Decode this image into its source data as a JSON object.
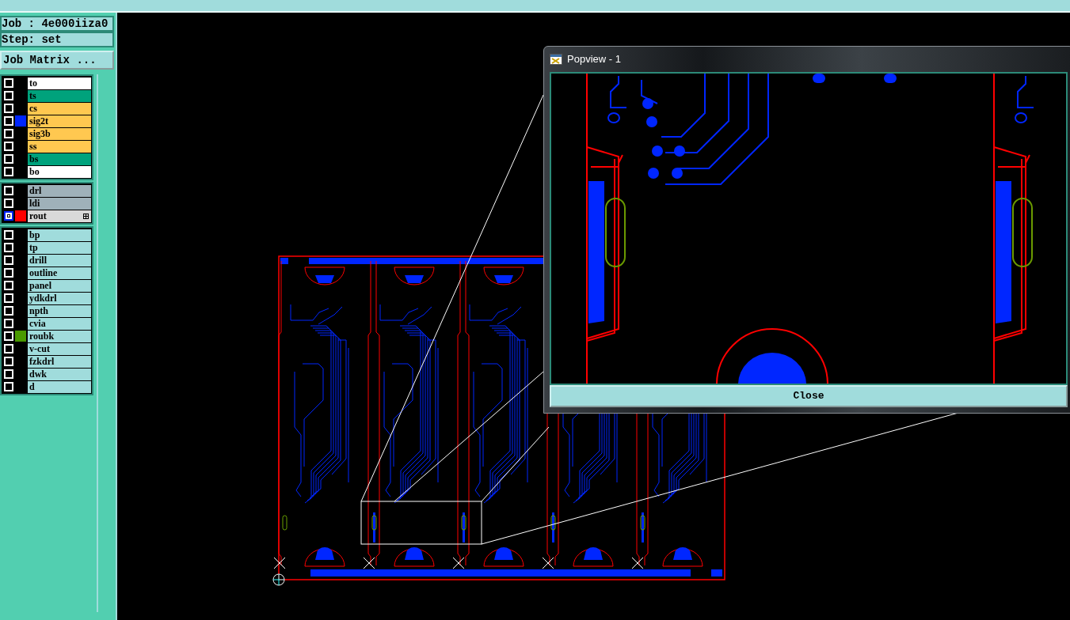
{
  "job_label": "Job : 4e000iiza0",
  "step_label": "Step: set",
  "job_matrix_button": "Job Matrix ...",
  "layer_groups": [
    {
      "layers": [
        {
          "name": "to",
          "color": "#ffffff",
          "selected": false
        },
        {
          "name": "ts",
          "color": "#00a27c",
          "selected": false
        },
        {
          "name": "cs",
          "color": "#ffc850",
          "selected": false
        },
        {
          "name": "sig2t",
          "color": "#ffc850",
          "swatch": {
            "color": "#0026ff"
          },
          "selected": false
        },
        {
          "name": "sig3b",
          "color": "#ffc850",
          "selected": false
        },
        {
          "name": "ss",
          "color": "#ffc850",
          "selected": false
        },
        {
          "name": "bs",
          "color": "#00a27c",
          "selected": false
        },
        {
          "name": "bo",
          "color": "#ffffff",
          "selected": false
        }
      ]
    },
    {
      "layers": [
        {
          "name": "drl",
          "color": "#9fb1b9",
          "selected": false
        },
        {
          "name": "ldi",
          "color": "#9fb1b9",
          "selected": false
        },
        {
          "name": "rout",
          "color": "#d9d9d9",
          "swatch": {
            "color": "#ff0000"
          },
          "selected": true
        }
      ]
    },
    {
      "layers": [
        {
          "name": "bp",
          "color": "#a0dcdc",
          "selected": false
        },
        {
          "name": "tp",
          "color": "#a0dcdc",
          "selected": false
        },
        {
          "name": "drill",
          "color": "#a0dcdc",
          "selected": false
        },
        {
          "name": "outline",
          "color": "#a0dcdc",
          "selected": false
        },
        {
          "name": "panel",
          "color": "#a0dcdc",
          "selected": false
        },
        {
          "name": "ydkdrl",
          "color": "#a0dcdc",
          "selected": false
        },
        {
          "name": "npth",
          "color": "#a0dcdc",
          "selected": false
        },
        {
          "name": "cvia",
          "color": "#a0dcdc",
          "selected": false
        },
        {
          "name": "roubk",
          "color": "#a0dcdc",
          "swatch": {
            "color": "#4a9a00"
          },
          "selected": false
        },
        {
          "name": "v-cut",
          "color": "#a0dcdc",
          "selected": false
        },
        {
          "name": "fzkdrl",
          "color": "#a0dcdc",
          "selected": false
        },
        {
          "name": "dwk",
          "color": "#a0dcdc",
          "selected": false
        },
        {
          "name": "d",
          "color": "#a0dcdc",
          "selected": false
        }
      ]
    }
  ],
  "popup": {
    "title": "Popview - 1",
    "close_button": "Close"
  }
}
